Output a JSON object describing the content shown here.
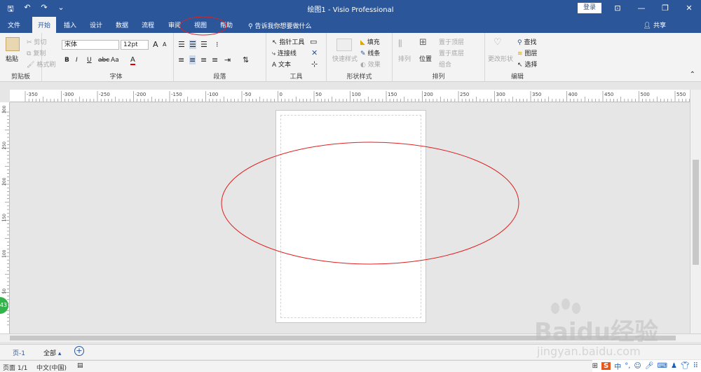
{
  "window": {
    "title": "绘图1  -  Visio Professional",
    "signin": "登录"
  },
  "qat": {
    "save": "🖫",
    "undo": "↶",
    "redo": "↷",
    "customize": "⌄"
  },
  "window_controls": {
    "ribbon_display": "⊡",
    "minimize": "—",
    "restore": "❐",
    "close": "✕"
  },
  "tabs": [
    "文件",
    "开始",
    "插入",
    "设计",
    "数据",
    "流程",
    "审阅",
    "视图",
    "帮助"
  ],
  "tellme": "告诉我你想要做什么",
  "share": "共享",
  "ribbon": {
    "clipboard": {
      "label": "剪贴板",
      "paste": "粘贴",
      "cut": "剪切",
      "copy": "复制",
      "format_painter": "格式刷"
    },
    "font": {
      "label": "字体",
      "font_name": "宋体",
      "font_size": "12pt",
      "bold": "B",
      "italic": "I",
      "underline": "U",
      "strike": "abc",
      "case": "Aa",
      "color": "A",
      "grow": "A",
      "shrink": "A"
    },
    "paragraph": {
      "label": "段落"
    },
    "tools": {
      "label": "工具",
      "pointer": "指针工具",
      "connector": "连接线",
      "text": "文本"
    },
    "shape_styles": {
      "label": "形状样式",
      "quick_styles": "快速样式",
      "fill": "填充",
      "line": "线条",
      "effects": "效果"
    },
    "arrange": {
      "label": "排列",
      "align": "排列",
      "position": "位置",
      "bring_front": "置于顶层",
      "send_back": "置于底层",
      "group": "组合"
    },
    "editing": {
      "label": "编辑",
      "change_shape": "更改形状",
      "find": "查找",
      "layers": "图层",
      "select": "选择"
    }
  },
  "ruler_top_labels": [
    "-350",
    "-300",
    "-250",
    "-200",
    "-150",
    "-100",
    "-50",
    "0",
    "50",
    "100",
    "150",
    "200",
    "250",
    "300",
    "350",
    "400",
    "450",
    "500",
    "550"
  ],
  "ruler_left_labels": [
    "300",
    "250",
    "200",
    "150",
    "100",
    "50"
  ],
  "page_tabs": {
    "page": "页-1",
    "all": "全部",
    "add": "+"
  },
  "status": {
    "page": "页面 1/1",
    "language": "中文(中国)"
  },
  "ime": {
    "logo": "S",
    "mode": "中",
    "punct": "°,"
  },
  "badge": "43",
  "watermark": {
    "brand": "Baidu经验",
    "url": "jingyan.baidu.com"
  },
  "colors": {
    "accent": "#2b579a",
    "annotation": "#e02020"
  }
}
